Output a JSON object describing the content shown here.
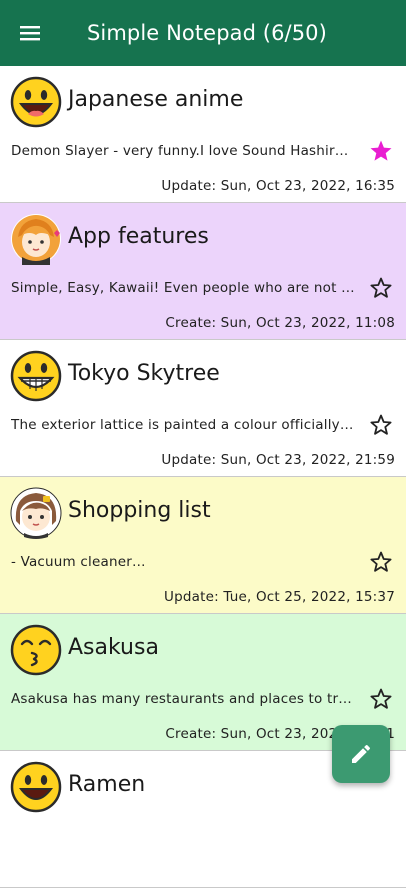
{
  "appbar": {
    "title": "Simple Notepad (6/50)",
    "menu_icon": "hamburger-menu-icon",
    "color": "#16734f"
  },
  "notes": [
    {
      "title": "Japanese anime",
      "body": "Demon Slayer - very funny.I love Sound Hashira U…",
      "date": "Update: Sun, Oct 23, 2022, 16:35",
      "background": "#ffffff",
      "starred": true,
      "avatar_icon": "smiley-face-icon"
    },
    {
      "title": "App features",
      "body": "Simple, Easy, Kawaii! Even people who are not go…",
      "date": "Create: Sun, Oct 23, 2022, 11:08",
      "background": "#ecd4fb",
      "starred": false,
      "avatar_icon": "orange-hair-girl-icon"
    },
    {
      "title": "Tokyo Skytree",
      "body": "The exterior lattice is painted a colour officially c…",
      "date": "Update: Sun, Oct 23, 2022, 21:59",
      "background": "#ffffff",
      "starred": false,
      "avatar_icon": "grinning-face-icon"
    },
    {
      "title": "Shopping list",
      "body": "- Vacuum cleaner…",
      "date": "Update: Tue, Oct 25, 2022, 15:37",
      "background": "#fcfbc8",
      "starred": false,
      "avatar_icon": "brown-hair-girl-icon"
    },
    {
      "title": "Asakusa",
      "body": "Asakusa has many restaurants and places to try …",
      "date": "Create: Sun, Oct 23, 2022, 22:01",
      "background": "#d7fad7",
      "starred": false,
      "avatar_icon": "kissing-face-icon"
    },
    {
      "title": "Ramen",
      "body": "",
      "date": "",
      "background": "#ffffff",
      "starred": false,
      "avatar_icon": "smiley-face-icon"
    }
  ],
  "fab": {
    "icon": "pencil-icon",
    "color": "#3c9a71"
  },
  "colors": {
    "star_active": "#e91ed1",
    "star_outline": "#222222"
  }
}
